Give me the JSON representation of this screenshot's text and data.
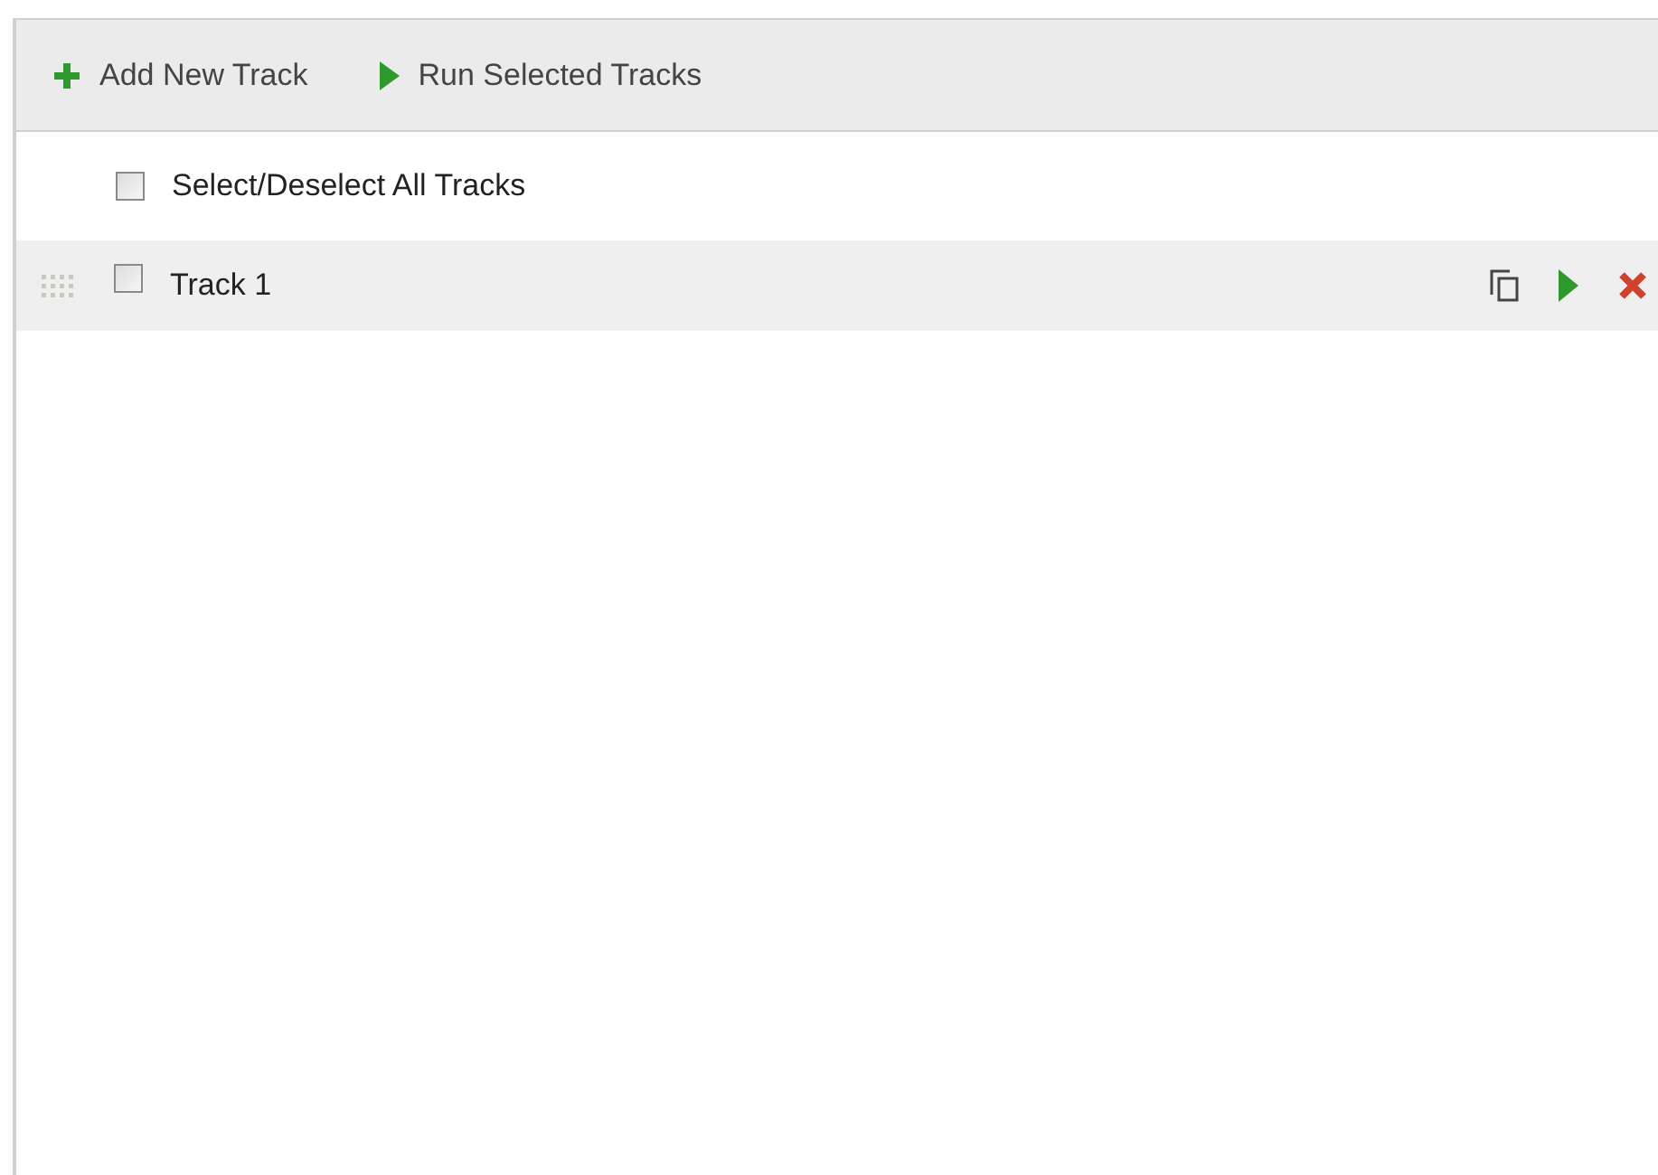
{
  "toolbar": {
    "buttons": [
      {
        "kind": "add",
        "label": "Add New Track"
      },
      {
        "kind": "run",
        "label": "Run Selected Tracks"
      }
    ]
  },
  "select_all": {
    "label": "Select/Deselect All Tracks",
    "checked": false
  },
  "tracks": [
    {
      "label": "Track 1",
      "checked": false
    }
  ]
}
